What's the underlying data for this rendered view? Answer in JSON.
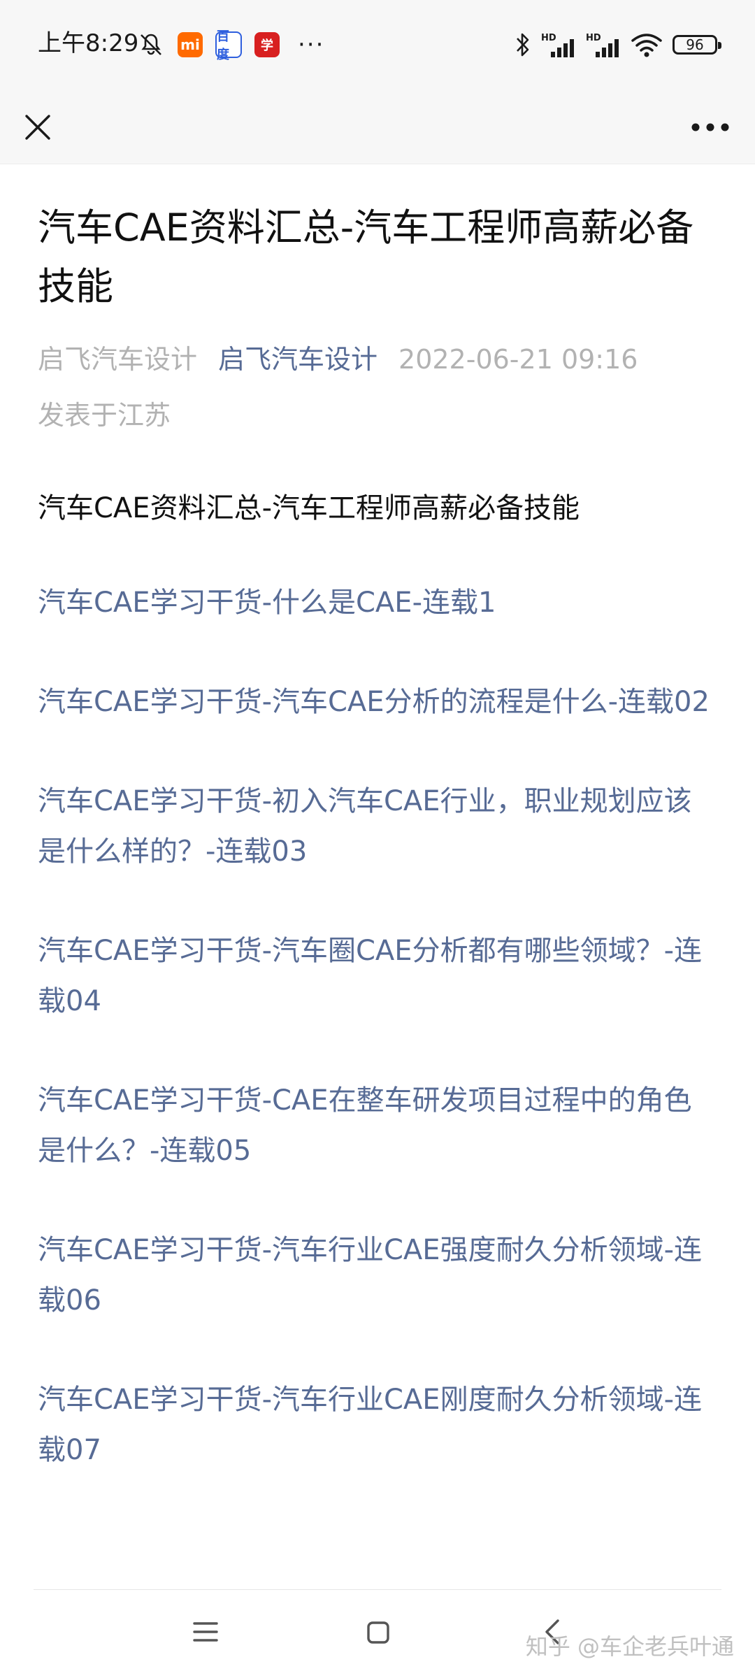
{
  "status_bar": {
    "time": "上午8:29",
    "app_badges": [
      "mi",
      "百度",
      "学"
    ],
    "more": "···",
    "battery": "96",
    "network_labels": [
      "HD",
      "HD"
    ]
  },
  "topnav": {
    "close_icon": "close-icon",
    "more_icon": "more-horizontal-icon"
  },
  "article": {
    "title": "汽车CAE资料汇总-汽车工程师高薪必备技能",
    "author": "启飞汽车设计",
    "account": "启飞汽车设计",
    "date": "2022-06-21 09:16",
    "location": "发表于江苏",
    "intro": "汽车CAE资料汇总-汽车工程师高薪必备技能",
    "links": [
      "汽车CAE学习干货-什么是CAE-连载1",
      "汽车CAE学习干货-汽车CAE分析的流程是什么-连载02",
      "汽车CAE学习干货-初入汽车CAE行业，职业规划应该是什么样的？-连载03",
      "汽车CAE学习干货-汽车圈CAE分析都有哪些领域？-连载04",
      "汽车CAE学习干货-CAE在整车研发项目过程中的角色是什么？-连载05",
      "汽车CAE学习干货-汽车行业CAE强度耐久分析领域-连载06",
      "汽车CAE学习干货-汽车行业CAE刚度耐久分析领域-连载07"
    ]
  },
  "navbar": {
    "menu_icon": "menu-icon",
    "home_icon": "home-square-icon",
    "back_icon": "back-chevron-icon"
  },
  "watermark": "知乎 @车企老兵叶通",
  "colors": {
    "link": "#576b95",
    "meta": "#b2b2b2",
    "title": "#111111",
    "bar_bg": "#f7f7f7"
  }
}
